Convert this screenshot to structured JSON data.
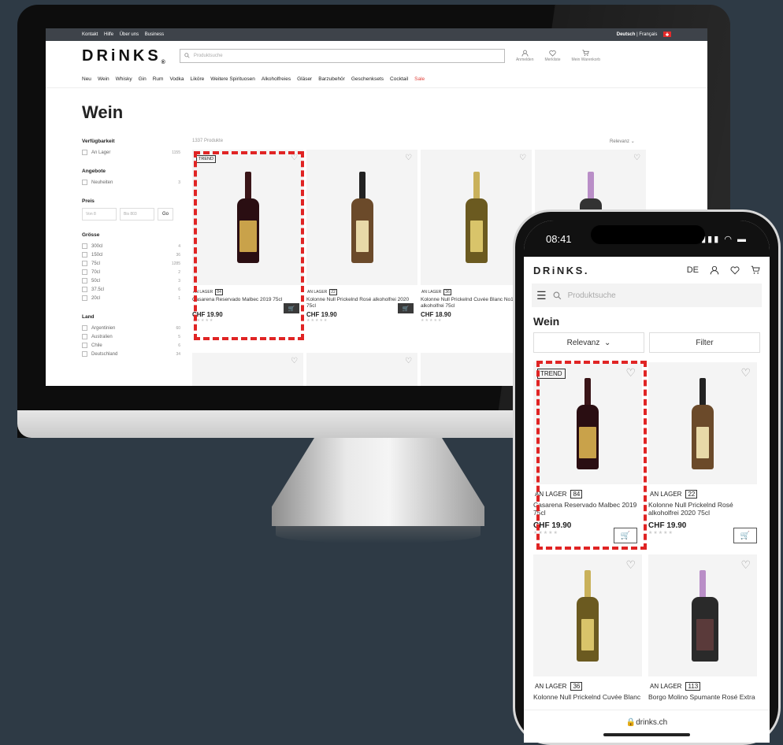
{
  "desktop": {
    "topbar": {
      "links": [
        "Kontakt",
        "Hilfe",
        "Über uns",
        "Business"
      ],
      "lang_active": "Deutsch",
      "lang_sep": "|",
      "lang_other": "Français"
    },
    "logo": "DRiNKS",
    "logo_mark": "®",
    "search_placeholder": "Produktsuche",
    "header_icons": [
      {
        "icon": "user-icon",
        "label": "Anmelden"
      },
      {
        "icon": "heart-icon",
        "label": "Merkliste"
      },
      {
        "icon": "cart-icon",
        "label": "Mein Warenkorb"
      }
    ],
    "nav": [
      "Neu",
      "Wein",
      "Whisky",
      "Gin",
      "Rum",
      "Vodka",
      "Liköre",
      "Weitere Spirituosen",
      "Alkoholfreies",
      "Gläser",
      "Barzubehör",
      "Geschenksets",
      "Cocktail"
    ],
    "nav_sale": "Sale",
    "page_title": "Wein",
    "filters": {
      "availability": {
        "title": "Verfügbarkeit",
        "items": [
          {
            "label": "An Lager",
            "count": "1155"
          }
        ]
      },
      "offers": {
        "title": "Angebote",
        "items": [
          {
            "label": "Neuheiten",
            "count": "3"
          }
        ]
      },
      "price": {
        "title": "Preis",
        "from": "Von 8",
        "to": "Bis 803",
        "go": "Go"
      },
      "size": {
        "title": "Grösse",
        "items": [
          {
            "label": "300cl",
            "count": "4"
          },
          {
            "label": "150cl",
            "count": "36"
          },
          {
            "label": "75cl",
            "count": "1285"
          },
          {
            "label": "70cl",
            "count": "2"
          },
          {
            "label": "50cl",
            "count": "3"
          },
          {
            "label": "37.5cl",
            "count": "6"
          },
          {
            "label": "20cl",
            "count": "1"
          }
        ]
      },
      "country": {
        "title": "Land",
        "items": [
          {
            "label": "Argentinien",
            "count": "60"
          },
          {
            "label": "Australien",
            "count": "5"
          },
          {
            "label": "Chile",
            "count": "6"
          },
          {
            "label": "Deutschland",
            "count": "34"
          }
        ]
      }
    },
    "results_count": "1337 Produkte",
    "sort": "Relevanz",
    "products": [
      {
        "trend": "TREND",
        "stock": "AN LAGER",
        "qty": "84",
        "name": "Casarena Reservado Malbec 2019 75cl",
        "price": "CHF 19.90",
        "stars": "★★★★★"
      },
      {
        "stock": "AN LAGER",
        "qty": "22",
        "name": "Kolonne Null Prickelnd Rosé alkoholfrei 2020 75cl",
        "price": "CHF 19.90",
        "stars": "★★★★★"
      },
      {
        "stock": "AN LAGER",
        "qty": "36",
        "name": "Kolonne Null Prickelnd Cuvée Blanc No1 alkoholfrei 75cl",
        "price": "CHF 18.90",
        "stars": "★★★★★"
      }
    ]
  },
  "mobile": {
    "time": "08:41",
    "status_icons": "▮▮▮ ◠ ▬",
    "logo": "DRiNKS",
    "logo_mark": ".",
    "lang": "DE",
    "search_placeholder": "Produktsuche",
    "page_title": "Wein",
    "sort": "Relevanz",
    "filter": "Filter",
    "products": [
      {
        "trend": "TREND",
        "stock": "AN LAGER",
        "qty": "84",
        "name": "Casarena Reservado Malbec 2019 75cl",
        "price": "CHF 19.90",
        "stars": "★★★★★"
      },
      {
        "stock": "AN LAGER",
        "qty": "22",
        "name": "Kolonne Null Prickelnd Rosé alkoholfrei 2020 75cl",
        "price": "CHF 19.90",
        "stars": "★★★★★"
      },
      {
        "stock": "AN LAGER",
        "qty": "36",
        "name": "Kolonne Null Prickelnd Cuvée Blanc",
        "price": "",
        "stars": ""
      },
      {
        "stock": "AN LAGER",
        "qty": "113",
        "name": "Borgo Molino Spumante Rosé Extra",
        "price": "",
        "stars": ""
      }
    ],
    "url": "drinks.ch"
  },
  "colors": {
    "background": "#2e3a45",
    "accent_red": "#e02424",
    "sale": "#e0413a",
    "topbar": "#3e434a"
  }
}
